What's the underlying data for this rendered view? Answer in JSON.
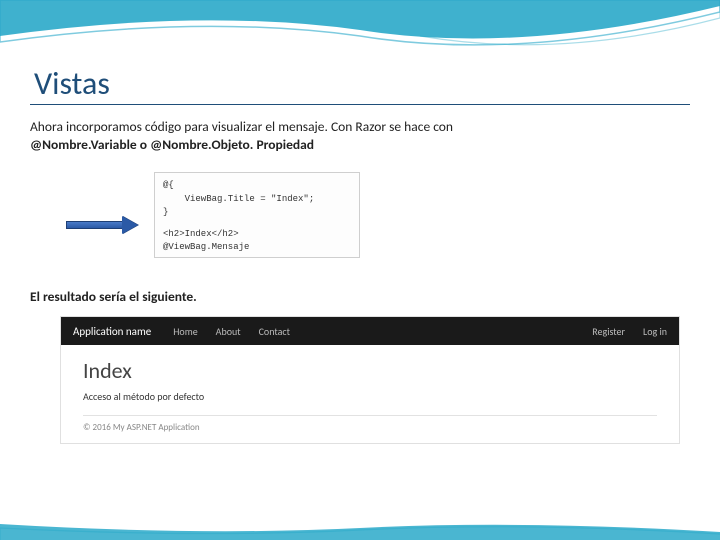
{
  "slide": {
    "title": "Vistas",
    "paragraph_line1": "Ahora incorporamos código para visualizar el mensaje. Con Razor se hace con",
    "paragraph_line2": "@Nombre.Variable o @Nombre.Objeto. Propiedad",
    "result_label": "El resultado sería el siguiente."
  },
  "code": {
    "l1": "@{",
    "l2": "    ViewBag.Title = \"Index\";",
    "l3": "}",
    "l4": "<h2>Index</h2>",
    "l5": "@ViewBag.Mensaje"
  },
  "browser": {
    "nav": {
      "brand": "Application name",
      "items": [
        "Home",
        "About",
        "Contact"
      ],
      "right": [
        "Register",
        "Log in"
      ]
    },
    "page_heading": "Index",
    "message": "Acceso al método por defecto",
    "footer": "© 2016   My ASP.NET Application"
  },
  "colors": {
    "accent": "#1f4e79",
    "arrow": "#2b5aa6",
    "navbar": "#1a1a1a"
  }
}
